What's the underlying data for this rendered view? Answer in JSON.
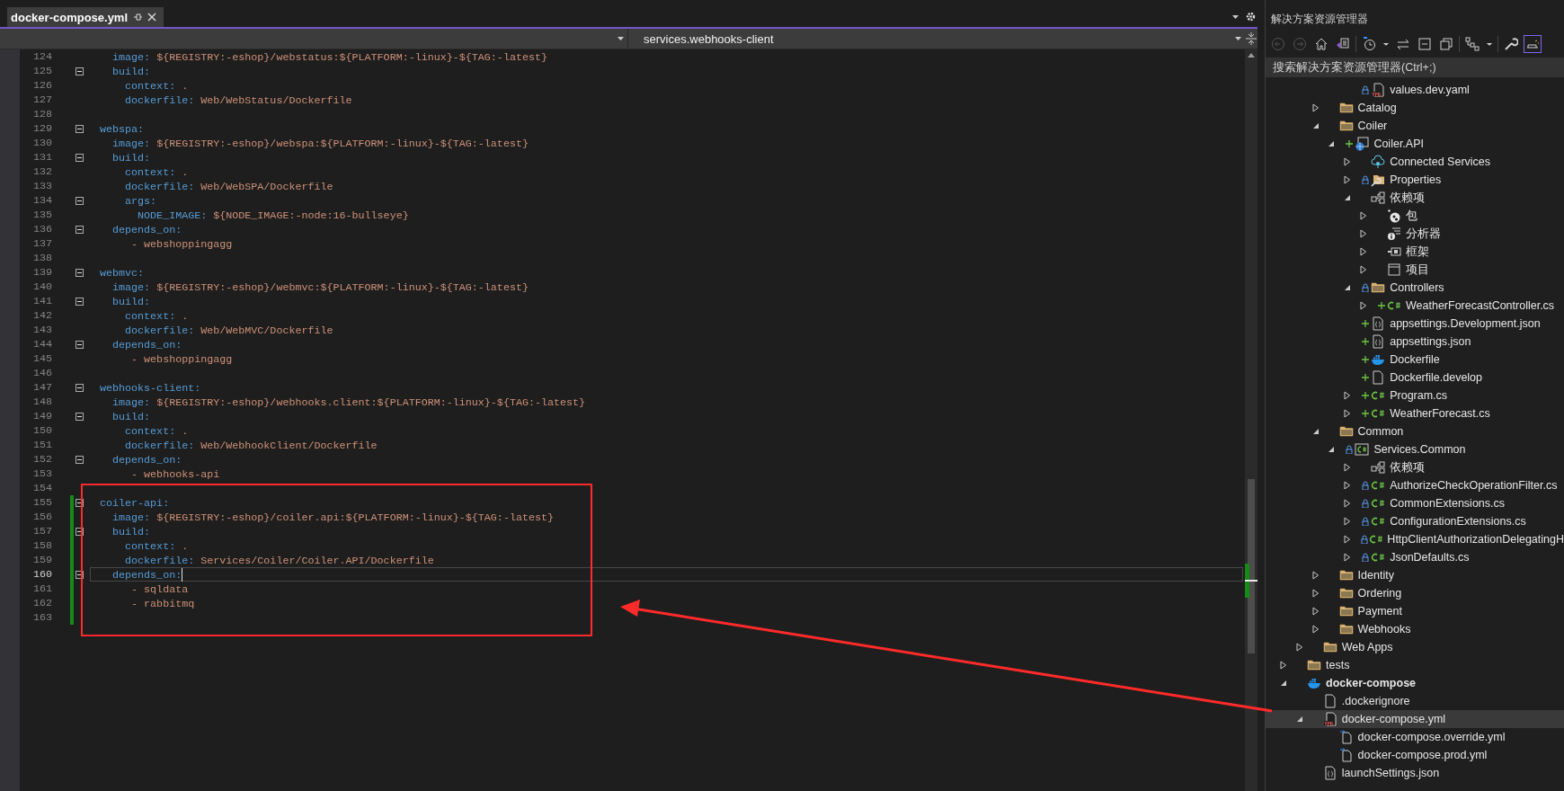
{
  "editor": {
    "tabs": [
      {
        "label": "docker-compose.yml",
        "selected": true
      }
    ],
    "navigation": {
      "scope_dropdown": {
        "kind": "dropdown"
      },
      "member_dropdown": {
        "value": "services.webhooks-client"
      }
    },
    "lines": [
      {
        "number": "124",
        "key": "  image:",
        "value": "${REGISTRY:-eshop}/webstatus:${PLATFORM:-linux}-${TAG:-latest}",
        "fold": false,
        "changed": false,
        "current": false
      },
      {
        "number": "125",
        "key": "  build:",
        "fold": true,
        "changed": false,
        "current": false
      },
      {
        "number": "126",
        "key": "    context:",
        "value": ".",
        "fold": false,
        "changed": false,
        "current": false
      },
      {
        "number": "127",
        "key": "    dockerfile:",
        "value": "Web/WebStatus/Dockerfile",
        "fold": false,
        "changed": false,
        "current": false
      },
      {
        "number": "128",
        "fold": false,
        "changed": false,
        "current": false
      },
      {
        "number": "129",
        "key": "webspa:",
        "fold": true,
        "changed": false,
        "current": false
      },
      {
        "number": "130",
        "key": "  image:",
        "value": "${REGISTRY:-eshop}/webspa:${PLATFORM:-linux}-${TAG:-latest}",
        "fold": false,
        "changed": false,
        "current": false
      },
      {
        "number": "131",
        "key": "  build:",
        "fold": true,
        "changed": false,
        "current": false
      },
      {
        "number": "132",
        "key": "    context:",
        "value": ".",
        "fold": false,
        "changed": false,
        "current": false
      },
      {
        "number": "133",
        "key": "    dockerfile:",
        "value": "Web/WebSPA/Dockerfile",
        "fold": false,
        "changed": false,
        "current": false
      },
      {
        "number": "134",
        "key": "    args:",
        "fold": true,
        "changed": false,
        "current": false
      },
      {
        "number": "135",
        "key": "      NODE_IMAGE:",
        "value": "${NODE_IMAGE:-node:16-bullseye}",
        "fold": false,
        "changed": false,
        "current": false
      },
      {
        "number": "136",
        "key": "  depends_on:",
        "fold": true,
        "changed": false,
        "current": false
      },
      {
        "number": "137",
        "value": "    - webshoppingagg",
        "fold": false,
        "changed": false,
        "current": false
      },
      {
        "number": "138",
        "fold": false,
        "changed": false,
        "current": false
      },
      {
        "number": "139",
        "key": "webmvc:",
        "fold": true,
        "changed": false,
        "current": false
      },
      {
        "number": "140",
        "key": "  image:",
        "value": "${REGISTRY:-eshop}/webmvc:${PLATFORM:-linux}-${TAG:-latest}",
        "fold": false,
        "changed": false,
        "current": false
      },
      {
        "number": "141",
        "key": "  build:",
        "fold": true,
        "changed": false,
        "current": false
      },
      {
        "number": "142",
        "key": "    context:",
        "value": ".",
        "fold": false,
        "changed": false,
        "current": false
      },
      {
        "number": "143",
        "key": "    dockerfile:",
        "value": "Web/WebMVC/Dockerfile",
        "fold": false,
        "changed": false,
        "current": false
      },
      {
        "number": "144",
        "key": "  depends_on:",
        "fold": true,
        "changed": false,
        "current": false
      },
      {
        "number": "145",
        "value": "    - webshoppingagg",
        "fold": false,
        "changed": false,
        "current": false
      },
      {
        "number": "146",
        "fold": false,
        "changed": false,
        "current": false
      },
      {
        "number": "147",
        "key": "webhooks-client:",
        "fold": true,
        "changed": false,
        "current": false
      },
      {
        "number": "148",
        "key": "  image:",
        "value": "${REGISTRY:-eshop}/webhooks.client:${PLATFORM:-linux}-${TAG:-latest}",
        "fold": false,
        "changed": false,
        "current": false
      },
      {
        "number": "149",
        "key": "  build:",
        "fold": true,
        "changed": false,
        "current": false
      },
      {
        "number": "150",
        "key": "    context:",
        "value": ".",
        "fold": false,
        "changed": false,
        "current": false
      },
      {
        "number": "151",
        "key": "    dockerfile:",
        "value": "Web/WebhookClient/Dockerfile",
        "fold": false,
        "changed": false,
        "current": false
      },
      {
        "number": "152",
        "key": "  depends_on:",
        "fold": true,
        "changed": false,
        "current": false
      },
      {
        "number": "153",
        "value": "    - webhooks-api",
        "fold": false,
        "changed": false,
        "current": false
      },
      {
        "number": "154",
        "fold": false,
        "changed": false,
        "current": false
      },
      {
        "number": "155",
        "key": "coiler-api:",
        "fold": true,
        "changed": true,
        "current": false
      },
      {
        "number": "156",
        "key": "  image:",
        "value": "${REGISTRY:-eshop}/coiler.api:${PLATFORM:-linux}-${TAG:-latest}",
        "fold": false,
        "changed": true,
        "current": false
      },
      {
        "number": "157",
        "key": "  build:",
        "fold": true,
        "changed": true,
        "current": false
      },
      {
        "number": "158",
        "key": "    context:",
        "value": ".",
        "fold": false,
        "changed": true,
        "current": false
      },
      {
        "number": "159",
        "key": "    dockerfile:",
        "value": "Services/Coiler/Coiler.API/Dockerfile",
        "fold": false,
        "changed": true,
        "current": false
      },
      {
        "number": "160",
        "key": "  depends_on:",
        "fold": true,
        "changed": true,
        "current": true
      },
      {
        "number": "161",
        "value": "    - sqldata",
        "fold": false,
        "changed": true,
        "current": false
      },
      {
        "number": "162",
        "value": "    - rabbitmq",
        "fold": false,
        "changed": true,
        "current": false
      },
      {
        "number": "163",
        "fold": false,
        "changed": true,
        "current": false
      }
    ],
    "annotations": {
      "highlight_box": true,
      "arrow": true
    }
  },
  "solution_explorer": {
    "title": "解决方案资源管理器",
    "toolbar": [
      {
        "kind": "back",
        "disabled": true,
        "selected": false
      },
      {
        "kind": "forward",
        "disabled": true,
        "selected": false
      },
      {
        "kind": "home",
        "disabled": false,
        "selected": false
      },
      {
        "kind": "switch-views",
        "disabled": false,
        "selected": false
      },
      {
        "kind": "pending-changes",
        "disabled": false,
        "selected": false
      },
      {
        "kind": "caret",
        "disabled": false,
        "selected": false
      },
      {
        "kind": "sync",
        "disabled": false,
        "selected": false
      },
      {
        "kind": "collapse",
        "disabled": false,
        "selected": false
      },
      {
        "kind": "copy",
        "disabled": false,
        "selected": false
      },
      {
        "kind": "hierarchy",
        "disabled": false,
        "selected": false
      },
      {
        "kind": "caret",
        "disabled": false,
        "selected": false
      },
      {
        "kind": "properties",
        "disabled": false,
        "selected": false
      },
      {
        "kind": "preview",
        "disabled": false,
        "selected": true
      }
    ],
    "search": {
      "placeholder": "搜索解决方案资源管理器(Ctrl+;)"
    },
    "tree": [
      {
        "children": [
          {
            "children": [
              {
                "children": [
                  {
                    "children": [
                      {
                        "label": "values.dev.yaml",
                        "kind": "yaml",
                        "locked": true,
                        "added": false,
                        "selected": false
                      }
                    ]
                  }
                ]
              },
              {
                "label": "Catalog",
                "kind": "folder",
                "expanded": false,
                "locked": false,
                "added": false,
                "selected": false
              },
              {
                "label": "Coiler",
                "kind": "folder",
                "expanded": true,
                "locked": false,
                "added": false,
                "selected": false,
                "children": [
                  {
                    "label": "Coiler.API",
                    "kind": "web-project",
                    "expanded": true,
                    "locked": false,
                    "added": true,
                    "selected": false,
                    "children": [
                      {
                        "label": "Connected Services",
                        "kind": "connected",
                        "expanded": false,
                        "locked": false,
                        "added": false,
                        "selected": false
                      },
                      {
                        "label": "Properties",
                        "kind": "properties",
                        "expanded": false,
                        "locked": true,
                        "added": false,
                        "selected": false
                      },
                      {
                        "label": "依赖项",
                        "kind": "dependencies",
                        "expanded": true,
                        "locked": false,
                        "added": false,
                        "selected": false,
                        "children": [
                          {
                            "label": "包",
                            "kind": "package",
                            "expanded": false,
                            "locked": false,
                            "added": false,
                            "selected": false
                          },
                          {
                            "label": "分析器",
                            "kind": "analyzer",
                            "expanded": false,
                            "locked": false,
                            "added": false,
                            "selected": false
                          },
                          {
                            "label": "框架",
                            "kind": "framework",
                            "expanded": false,
                            "locked": false,
                            "added": false,
                            "selected": false
                          },
                          {
                            "label": "项目",
                            "kind": "window",
                            "expanded": false,
                            "locked": false,
                            "added": false,
                            "selected": false
                          }
                        ]
                      },
                      {
                        "label": "Controllers",
                        "kind": "folder",
                        "expanded": true,
                        "locked": true,
                        "added": false,
                        "selected": false,
                        "children": [
                          {
                            "label": "WeatherForecastController.cs",
                            "kind": "csharp",
                            "expanded": false,
                            "locked": false,
                            "added": true,
                            "selected": false
                          }
                        ]
                      },
                      {
                        "label": "appsettings.Development.json",
                        "kind": "json",
                        "locked": false,
                        "added": true,
                        "selected": false
                      },
                      {
                        "label": "appsettings.json",
                        "kind": "json",
                        "locked": false,
                        "added": true,
                        "selected": false
                      },
                      {
                        "label": "Dockerfile",
                        "kind": "docker",
                        "locked": false,
                        "added": true,
                        "selected": false
                      },
                      {
                        "label": "Dockerfile.develop",
                        "kind": "file",
                        "locked": false,
                        "added": true,
                        "selected": false
                      },
                      {
                        "label": "Program.cs",
                        "kind": "csharp",
                        "expanded": false,
                        "locked": false,
                        "added": true,
                        "selected": false
                      },
                      {
                        "label": "WeatherForecast.cs",
                        "kind": "csharp",
                        "expanded": false,
                        "locked": false,
                        "added": true,
                        "selected": false
                      }
                    ]
                  }
                ]
              },
              {
                "label": "Common",
                "kind": "folder",
                "expanded": true,
                "locked": false,
                "added": false,
                "selected": false,
                "children": [
                  {
                    "label": "Services.Common",
                    "kind": "cs-project",
                    "expanded": true,
                    "locked": true,
                    "added": false,
                    "selected": false,
                    "children": [
                      {
                        "label": "依赖项",
                        "kind": "dependencies",
                        "expanded": false,
                        "locked": false,
                        "added": false,
                        "selected": false
                      },
                      {
                        "label": "AuthorizeCheckOperationFilter.cs",
                        "kind": "csharp",
                        "expanded": false,
                        "locked": true,
                        "added": false,
                        "selected": false
                      },
                      {
                        "label": "CommonExtensions.cs",
                        "kind": "csharp",
                        "expanded": false,
                        "locked": true,
                        "added": false,
                        "selected": false
                      },
                      {
                        "label": "ConfigurationExtensions.cs",
                        "kind": "csharp",
                        "expanded": false,
                        "locked": true,
                        "added": false,
                        "selected": false
                      },
                      {
                        "label": "HttpClientAuthorizationDelegatingH",
                        "kind": "csharp",
                        "expanded": false,
                        "locked": true,
                        "added": false,
                        "selected": false
                      },
                      {
                        "label": "JsonDefaults.cs",
                        "kind": "csharp",
                        "expanded": false,
                        "locked": true,
                        "added": false,
                        "selected": false
                      }
                    ]
                  }
                ]
              },
              {
                "label": "Identity",
                "kind": "folder",
                "expanded": false,
                "locked": false,
                "added": false,
                "selected": false
              },
              {
                "label": "Ordering",
                "kind": "folder",
                "expanded": false,
                "locked": false,
                "added": false,
                "selected": false
              },
              {
                "label": "Payment",
                "kind": "folder",
                "expanded": false,
                "locked": false,
                "added": false,
                "selected": false
              },
              {
                "label": "Webhooks",
                "kind": "folder",
                "expanded": false,
                "locked": false,
                "added": false,
                "selected": false
              }
            ]
          },
          {
            "label": "Web Apps",
            "kind": "folder",
            "expanded": false,
            "locked": false,
            "added": false,
            "selected": false
          }
        ]
      },
      {
        "label": "tests",
        "kind": "folder",
        "expanded": false,
        "locked": false,
        "added": false,
        "selected": false
      },
      {
        "label": "docker-compose",
        "kind": "docker-project",
        "expanded": true,
        "locked": false,
        "added": false,
        "selected": false,
        "children": [
          {
            "label": ".dockerignore",
            "kind": "file",
            "locked": false,
            "added": false,
            "selected": false
          },
          {
            "label": "docker-compose.yml",
            "kind": "yaml",
            "expanded": true,
            "locked": false,
            "added": false,
            "selected": true,
            "children": [
              {
                "label": "docker-compose.override.yml",
                "kind": "linked-file",
                "locked": false,
                "added": false,
                "selected": false
              },
              {
                "label": "docker-compose.prod.yml",
                "kind": "linked-file",
                "locked": false,
                "added": false,
                "selected": false
              }
            ]
          },
          {
            "label": "launchSettings.json",
            "kind": "json",
            "locked": false,
            "added": false,
            "selected": false
          }
        ]
      }
    ]
  }
}
